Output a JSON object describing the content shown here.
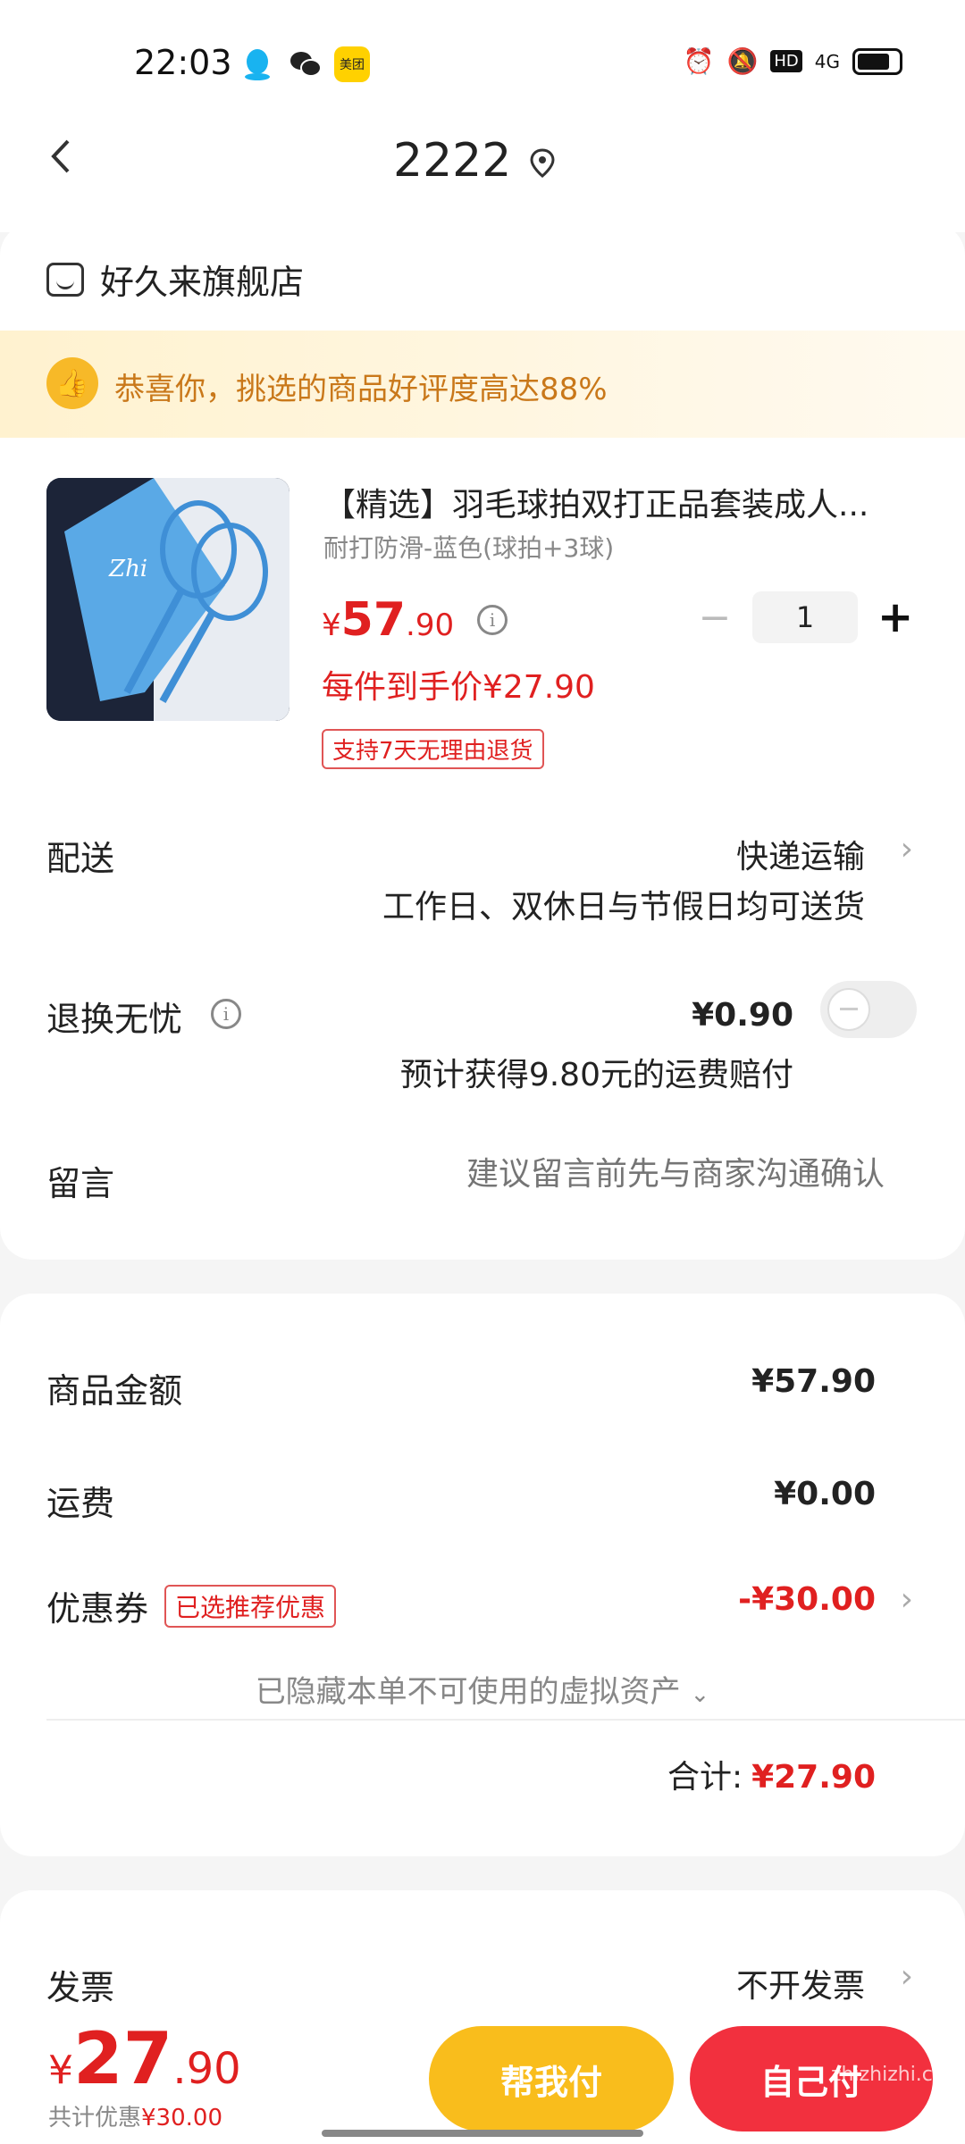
{
  "status_bar": {
    "time": "22:03",
    "network": "4G",
    "hd": "HD",
    "app3": "美团"
  },
  "header": {
    "address": "2222"
  },
  "shop": {
    "name": "好久来旗舰店"
  },
  "banner": {
    "text": "恭喜你，挑选的商品好评度高达88%"
  },
  "product": {
    "title": "【精选】羽毛球拍双打正品套装成人...",
    "variant": "耐打防滑-蓝色(球拍+3球)",
    "price_currency": "¥",
    "price_int": "57",
    "price_dec": ".90",
    "unit_price": "每件到手价¥27.90",
    "return_badge": "支持7天无理由退货",
    "quantity": "1",
    "minus": "−",
    "plus": "+"
  },
  "delivery": {
    "label": "配送",
    "method": "快递运输",
    "note": "工作日、双休日与节假日均可送货"
  },
  "worry_free": {
    "label": "退换无忧",
    "price": "¥0.90",
    "note": "预计获得9.80元的运费赔付",
    "enabled": false
  },
  "message": {
    "label": "留言",
    "placeholder": "建议留言前先与商家沟通确认"
  },
  "summary": {
    "goods_label": "商品金额",
    "goods_value": "¥57.90",
    "shipping_label": "运费",
    "shipping_value": "¥0.00",
    "coupon_label": "优惠券",
    "coupon_badge": "已选推荐优惠",
    "coupon_value": "-¥30.00",
    "hidden_assets": "已隐藏本单不可使用的虚拟资产",
    "total_label": "合计:",
    "total_value": "¥27.90"
  },
  "invoice": {
    "label": "发票",
    "value": "不开发票"
  },
  "bottom": {
    "currency": "¥",
    "total_int": "27",
    "total_dec": ".90",
    "discount_prefix": "共计优惠",
    "discount_value": "¥30.00",
    "help_pay": "帮我付",
    "self_pay": "自己付",
    "watermark": "zhizhizhi.com"
  },
  "colors": {
    "accent_red": "#e02020",
    "pay_button": "#f2303e",
    "help_button": "#f9bd1c",
    "banner_text": "#c9781a"
  }
}
